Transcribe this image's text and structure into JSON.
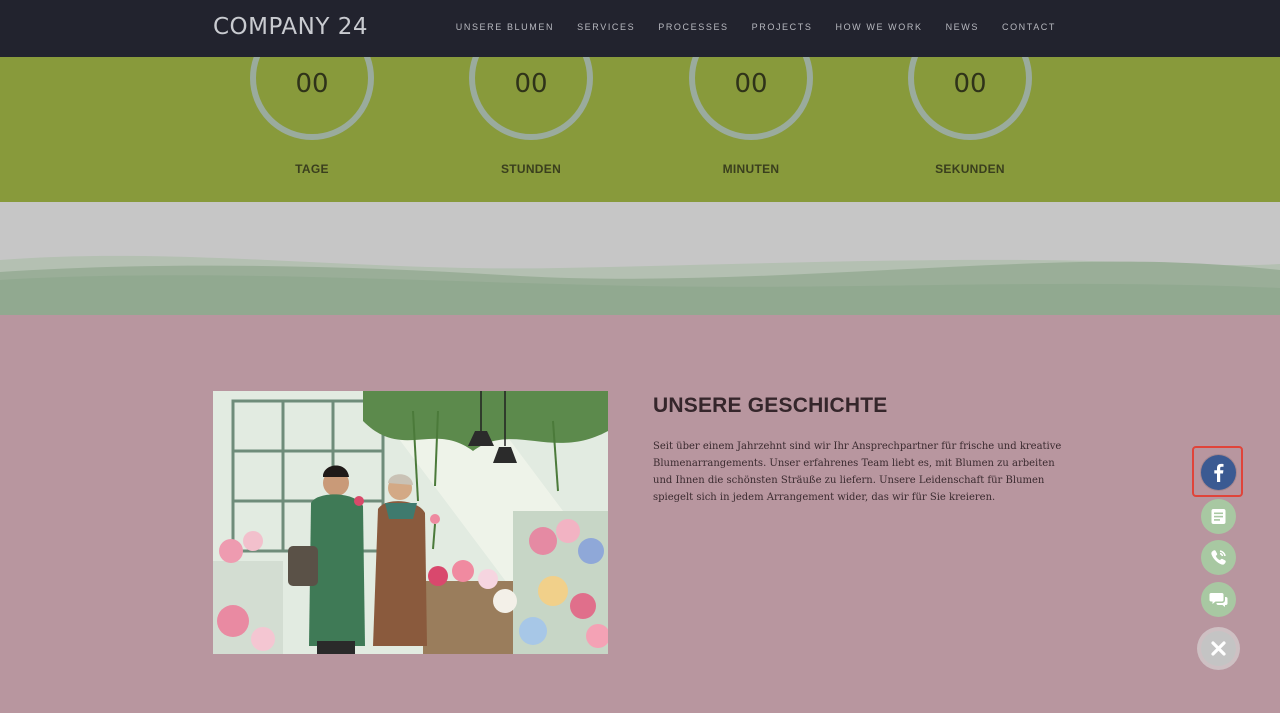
{
  "header": {
    "logo": "COMPANY 24",
    "nav": [
      "UNSERE BLUMEN",
      "SERVICES",
      "PROCESSES",
      "PROJECTS",
      "HOW WE WORK",
      "NEWS",
      "CONTACT"
    ]
  },
  "countdown": {
    "units": [
      {
        "value": "00",
        "label": "TAGE"
      },
      {
        "value": "00",
        "label": "STUNDEN"
      },
      {
        "value": "00",
        "label": "MINUTEN"
      },
      {
        "value": "00",
        "label": "SEKUNDEN"
      }
    ]
  },
  "story": {
    "title": "UNSERE GESCHICHTE",
    "text": "Seit über einem Jahrzehnt sind wir Ihr Ansprechpartner für frische und kreative Blumenarrangements. Unser erfahrenes Team liebt es, mit Blumen zu arbeiten und Ihnen die schönsten Sträuße zu liefern. Unsere Leidenschaft für Blumen spiegelt sich in jedem Arrangement wider, das wir für Sie kreieren."
  },
  "floating_actions": [
    {
      "icon": "facebook-icon",
      "color": "#3b5a92"
    },
    {
      "icon": "document-icon",
      "color": "#a8c8a2"
    },
    {
      "icon": "phone-icon",
      "color": "#a8c8a2"
    },
    {
      "icon": "chat-icon",
      "color": "#a8c8a2"
    },
    {
      "icon": "close-icon",
      "color": "#c4c4c4"
    }
  ],
  "colors": {
    "header_bg": "#22232e",
    "countdown_bg": "#889a3b",
    "story_bg": "#b8969f",
    "highlight": "#e0443a"
  }
}
